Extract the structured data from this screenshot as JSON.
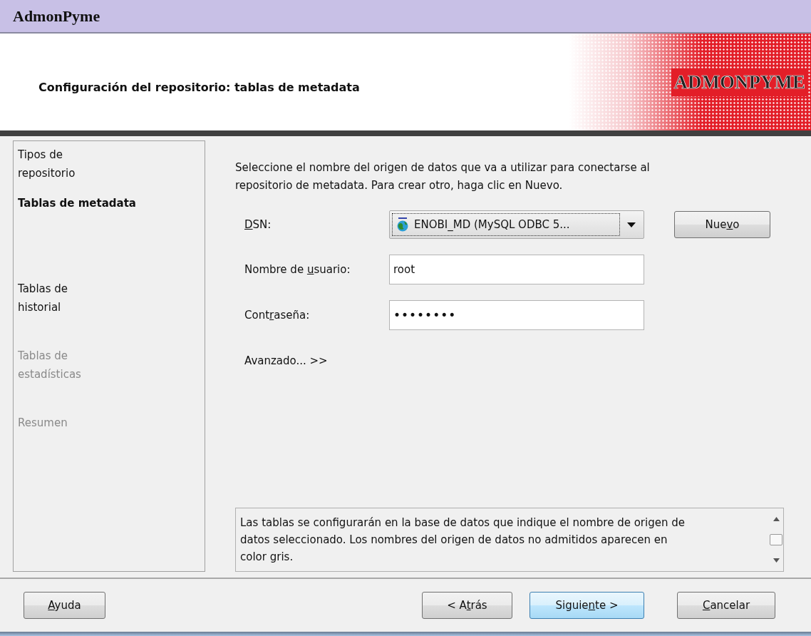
{
  "window": {
    "title": "AdmonPyme"
  },
  "header": {
    "title": "Configuración del repositorio: tablas de metadata",
    "logo": "ADMONPYME"
  },
  "steps": [
    {
      "label": "Tipos de repositorio",
      "selected": false,
      "disabled": false
    },
    {
      "label": "Tablas de metadata",
      "selected": true,
      "disabled": false
    },
    {
      "label": "Tablas de historial",
      "selected": false,
      "disabled": false
    },
    {
      "label": "Tablas de estadísticas",
      "selected": false,
      "disabled": true
    },
    {
      "label": "Resumen",
      "selected": false,
      "disabled": true
    }
  ],
  "intro": "Seleccione el nombre del origen de datos que va a utilizar para conectarse al repositorio de metadata. Para crear otro, haga clic en Nuevo.",
  "form": {
    "dsn": {
      "label": [
        {
          "text": "D",
          "underline": true
        },
        {
          "text": "SN:",
          "underline": false
        }
      ],
      "value": "ENOBI_MD (MySQL ODBC 5...",
      "button": [
        {
          "text": "Nue",
          "underline": false
        },
        {
          "text": "v",
          "underline": true
        },
        {
          "text": "o",
          "underline": false
        }
      ]
    },
    "user": {
      "label": [
        {
          "text": "Nombre de ",
          "underline": false
        },
        {
          "text": "u",
          "underline": true
        },
        {
          "text": "suario:",
          "underline": false
        }
      ],
      "value": "root"
    },
    "password": {
      "label": [
        {
          "text": "Cont",
          "underline": false
        },
        {
          "text": "r",
          "underline": true
        },
        {
          "text": "aseña:",
          "underline": false
        }
      ],
      "value": "••••••••"
    },
    "advanced": "Avanzado... >>"
  },
  "info": "Las tablas se configurarán en la base de datos que indique el nombre de origen de datos seleccionado. Los nombres del origen de datos no admitidos aparecen en color gris.",
  "buttons": {
    "help": [
      {
        "text": "A",
        "underline": true
      },
      {
        "text": "yuda",
        "underline": false
      }
    ],
    "back": [
      {
        "text": "< A",
        "underline": false
      },
      {
        "text": "t",
        "underline": true
      },
      {
        "text": "rás",
        "underline": false
      }
    ],
    "next": {
      "default": true,
      "label": [
        {
          "text": "Siguie",
          "underline": false
        },
        {
          "text": "n",
          "underline": true
        },
        {
          "text": "te >",
          "underline": false
        }
      ]
    },
    "cancel": [
      {
        "text": "C",
        "underline": true
      },
      {
        "text": "ancelar",
        "underline": false
      }
    ]
  }
}
